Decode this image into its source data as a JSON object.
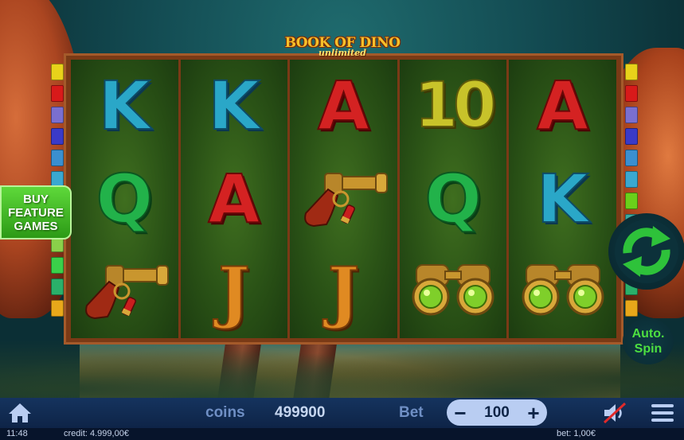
{
  "logo": {
    "line1": "BOOK OF DINO",
    "line2": "unlimited"
  },
  "colors": {
    "K": "#2aa7c8",
    "A": "#d42222",
    "Q": "#22b24a",
    "J": "#e08a22",
    "ten": "#c8c32a",
    "bar": "#15335e",
    "bet_box": "#b9cdf2",
    "buy_button": "#3fbd25",
    "spin": "#2ec23a"
  },
  "reels": [
    [
      "K",
      "Q",
      "flare-gun-icon"
    ],
    [
      "K",
      "A",
      "J"
    ],
    [
      "A",
      "flare-gun-icon",
      "J"
    ],
    [
      "10",
      "Q",
      "binoculars-icon"
    ],
    [
      "A",
      "K",
      "binoculars-icon"
    ]
  ],
  "buy_feature": {
    "line1": "BUY",
    "line2": "FEATURE",
    "line3": "GAMES"
  },
  "autospin": {
    "line1": "Auto.",
    "line2": "Spin"
  },
  "bottom_bar": {
    "coins_label": "coins",
    "coins_value": "499900",
    "bet_label": "Bet",
    "bet_value": "100",
    "minus": "−",
    "plus": "+"
  },
  "status_bar": {
    "time": "11:48",
    "credit": "credit: 4.999,00€",
    "bet": "bet: 1,00€"
  },
  "line_markers": {
    "left": [
      "#e8d21a",
      "#d81a1a",
      "#7a6fd0",
      "#3a3ac8",
      "#3a8fd0",
      "#3aa8d0",
      "#6ad01a",
      "#3aa8a0",
      "#8ad04a",
      "#3ad04a",
      "#2ab06a",
      "#e8a81a"
    ],
    "right": [
      "#e8d21a",
      "#d81a1a",
      "#7a6fd0",
      "#3a3ac8",
      "#3a8fd0",
      "#3aa8d0",
      "#6ad01a",
      "#3aa8a0",
      "#8ad04a",
      "#3ad04a",
      "#2ab06a",
      "#e8a81a"
    ]
  }
}
